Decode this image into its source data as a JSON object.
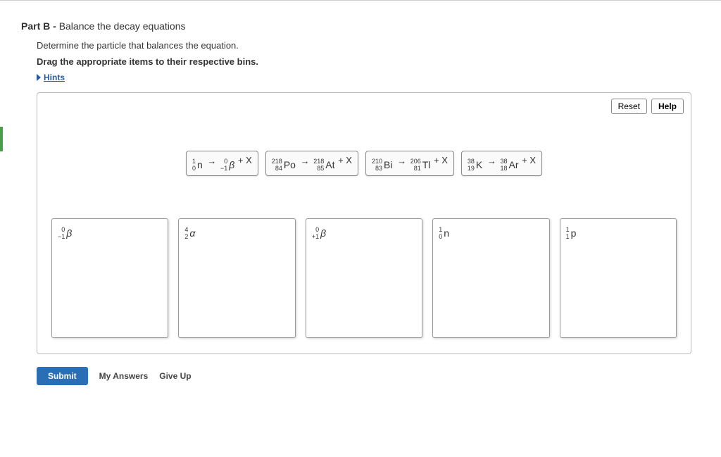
{
  "part": {
    "label": "Part B",
    "title": "Balance the decay equations"
  },
  "instructions": {
    "line1": "Determine the particle that balances the equation.",
    "line2": "Drag the appropriate items to their respective bins."
  },
  "hints": {
    "label": "Hints"
  },
  "toolbar": {
    "reset": "Reset",
    "help": "Help"
  },
  "items": [
    {
      "lhs": {
        "top": "1",
        "bot": "0",
        "sym": "n"
      },
      "rhs": {
        "top": "0",
        "bot": "−1",
        "sym": "β",
        "italic": true
      },
      "tail": " + X"
    },
    {
      "lhs": {
        "top": "218",
        "bot": "84",
        "sym": "Po"
      },
      "rhs": {
        "top": "218",
        "bot": "85",
        "sym": "At"
      },
      "tail": " + X"
    },
    {
      "lhs": {
        "top": "210",
        "bot": "83",
        "sym": "Bi"
      },
      "rhs": {
        "top": "206",
        "bot": "81",
        "sym": "Tl"
      },
      "tail": " + X"
    },
    {
      "lhs": {
        "top": "38",
        "bot": "19",
        "sym": "K"
      },
      "rhs": {
        "top": "38",
        "bot": "18",
        "sym": "Ar"
      },
      "tail": " + X"
    }
  ],
  "bins": [
    {
      "top": "0",
      "bot": "−1",
      "sym": "β",
      "italic": true
    },
    {
      "top": "4",
      "bot": "2",
      "sym": "α",
      "italic": true
    },
    {
      "top": "0",
      "bot": "+1",
      "sym": "β",
      "italic": true
    },
    {
      "top": "1",
      "bot": "0",
      "sym": "n"
    },
    {
      "top": "1",
      "bot": "1",
      "sym": "p"
    }
  ],
  "buttons": {
    "submit": "Submit",
    "myanswers": "My Answers",
    "giveup": "Give Up"
  }
}
